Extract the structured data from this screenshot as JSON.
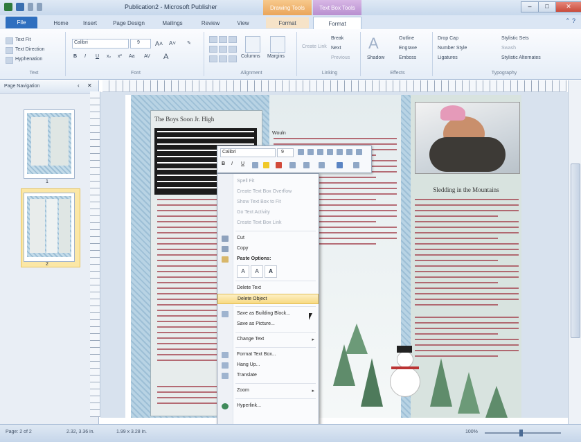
{
  "window": {
    "title": "Publication2 - Microsoft Publisher",
    "context_tab_drawing": "Drawing Tools",
    "context_tab_picture": "Text Box Tools",
    "minimize": "–",
    "maximize": "□",
    "close": "✕"
  },
  "ribbon_tabs": [
    {
      "label": "File"
    },
    {
      "label": "Home"
    },
    {
      "label": "Insert"
    },
    {
      "label": "Page Design"
    },
    {
      "label": "Mailings"
    },
    {
      "label": "Review"
    },
    {
      "label": "View"
    },
    {
      "label": "Format"
    },
    {
      "label": "Format"
    }
  ],
  "ribbon": {
    "text_group": {
      "label": "Text",
      "items": [
        "Text Fit",
        "Text Direction",
        "Hyphenation"
      ]
    },
    "font_group": {
      "label": "Font",
      "font_name": "Calibri",
      "font_size": "9"
    },
    "alignment_group": {
      "label": "Alignment",
      "columns": "Columns",
      "margins": "Margins"
    },
    "linking_group": {
      "label": "Linking",
      "items": [
        "Create Link",
        "Break",
        "Next",
        "Previous"
      ]
    },
    "effects_group": {
      "label": "Effects",
      "shadow": "Shadow",
      "items": [
        "Outline",
        "Engrave",
        "Emboss"
      ]
    },
    "typography_group": {
      "label": "Typography",
      "items": [
        "Drop Cap",
        "Number Style",
        "Ligatures",
        "Stylistic Sets",
        "Swash",
        "Stylistic Alternates"
      ]
    }
  },
  "page_navigation": {
    "title": "Page Navigation",
    "pages": [
      {
        "number": "1"
      },
      {
        "number": "2"
      }
    ]
  },
  "document": {
    "article_title": "The Boys Soon Jr. High",
    "right_title": "Sledding in the Mountains",
    "mid_heading": "Wouln"
  },
  "mini_toolbar": {
    "font": "Calibri",
    "size": "9"
  },
  "context_menu": {
    "items": [
      {
        "label": "Spell Fit",
        "disabled": true
      },
      {
        "label": "Create Text Box Overflow",
        "disabled": true
      },
      {
        "label": "Show Text Box to Fit",
        "disabled": true
      },
      {
        "label": "Go Text Activity",
        "disabled": true
      },
      {
        "label": "Create Text Box Link",
        "disabled": true
      },
      {
        "label": "Cut",
        "disabled": false
      },
      {
        "label": "Copy",
        "disabled": false
      },
      {
        "label": "Paste Options:",
        "disabled": false
      },
      {
        "label": "Delete Text",
        "disabled": false
      },
      {
        "label": "Delete Object",
        "disabled": false,
        "selected": true
      },
      {
        "label": "Save as Building Block...",
        "disabled": false
      },
      {
        "label": "Save as Picture...",
        "disabled": false
      },
      {
        "label": "Change Text",
        "disabled": false,
        "submenu": true
      },
      {
        "label": "Format Text Box...",
        "disabled": false
      },
      {
        "label": "Hang Up...",
        "disabled": false
      },
      {
        "label": "Translate",
        "disabled": false
      },
      {
        "label": "Zoom",
        "disabled": false,
        "submenu": true
      },
      {
        "label": "Hyperlink...",
        "disabled": false
      }
    ],
    "paste_options": [
      "A",
      "A",
      "A"
    ]
  },
  "status_bar": {
    "page": "Page: 2 of 2",
    "position": "2.32, 3.36 in.",
    "size": "1.99 x 3.28 in.",
    "zoom": "100%"
  },
  "colors": {
    "accent": "#2f6fbf",
    "menu_highlight": "#f7d981",
    "selected_thumb": "#fbe7a6"
  }
}
